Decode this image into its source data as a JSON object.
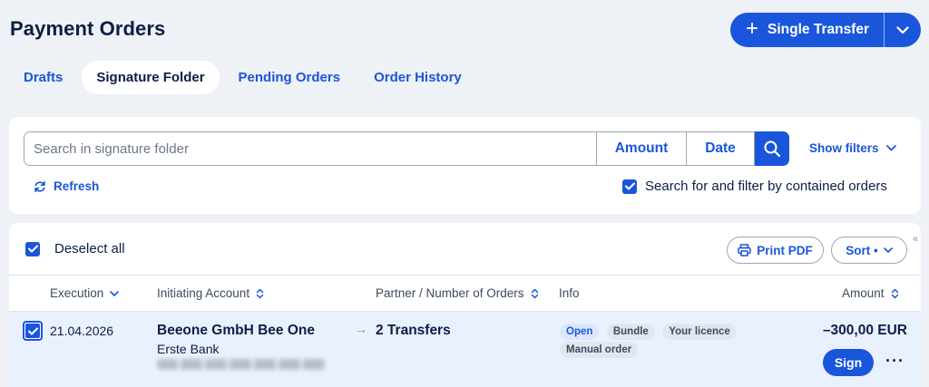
{
  "header": {
    "title": "Payment Orders",
    "primary_label": "Single Transfer"
  },
  "tabs": [
    {
      "label": "Drafts",
      "active": false
    },
    {
      "label": "Signature Folder",
      "active": true
    },
    {
      "label": "Pending Orders",
      "active": false
    },
    {
      "label": "Order History",
      "active": false
    }
  ],
  "search": {
    "placeholder": "Search in signature folder",
    "value": "",
    "amount_label": "Amount",
    "date_label": "Date",
    "show_filters_label": "Show filters",
    "refresh_label": "Refresh",
    "contained_label": "Search for and filter by contained orders",
    "contained_checked": true
  },
  "list": {
    "deselect_label": "Deselect all",
    "print_label": "Print PDF",
    "sort_label": "Sort •",
    "columns": {
      "execution": "Execution",
      "account": "Initiating Account",
      "partner": "Partner / Number of Orders",
      "info": "Info",
      "amount": "Amount"
    },
    "rows": [
      {
        "date": "21.04.2026",
        "account_name": "Beeone GmbH Bee One",
        "bank": "Erste Bank",
        "partner": "2 Transfers",
        "tags": [
          "Open",
          "Bundle",
          "Your licence"
        ],
        "tag_second_line": "Manual order",
        "amount": "–300,00 EUR",
        "sign_label": "Sign",
        "more_label": "···"
      }
    ]
  },
  "colors": {
    "accent": "#1a56db",
    "background": "#eef1f6",
    "row_selected": "#eaf1fe"
  }
}
